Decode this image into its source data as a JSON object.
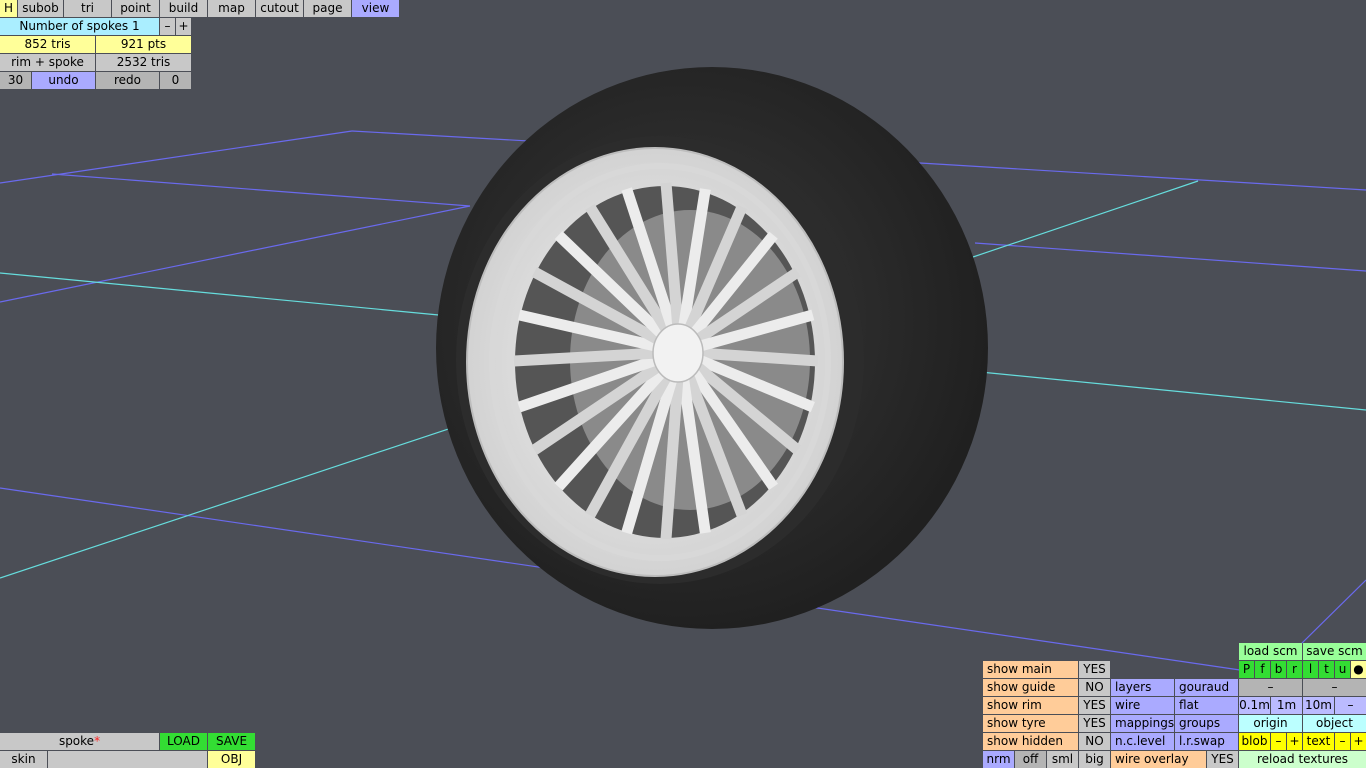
{
  "colors": {
    "background": "#4b4e56",
    "grid_blue": "#6a6aee",
    "grid_cyan": "#66dddd",
    "tyre": "#2a2a2a",
    "rim": "#e6e6e6"
  },
  "menu": {
    "h": "H",
    "subob": "subob",
    "tri": "tri",
    "point": "point",
    "build": "build",
    "map": "map",
    "cutout": "cutout",
    "page": "page",
    "view": "view"
  },
  "info": {
    "param_label": "Number of spokes 1",
    "minus": "–",
    "plus": "+",
    "tris": "852 tris",
    "pts": "921 pts",
    "selection": "rim + spoke",
    "sel_tris": "2532 tris",
    "undo_count": "30",
    "undo": "undo",
    "redo": "redo",
    "redo_count": "0"
  },
  "file": {
    "name": "spoke",
    "modified": "*",
    "load": "LOAD",
    "save": "SAVE",
    "skin": "skin",
    "skin_value": "",
    "obj": "OBJ"
  },
  "display": {
    "show_main": "show main",
    "show_main_val": "YES",
    "show_guide": "show guide",
    "show_guide_val": "NO",
    "show_rim": "show rim",
    "show_rim_val": "YES",
    "show_tyre": "show tyre",
    "show_tyre_val": "YES",
    "show_hidden": "show hidden",
    "show_hidden_val": "NO",
    "layers": "layers",
    "gouraud": "gouraud",
    "wire": "wire",
    "flat": "flat",
    "mappings": "mappings",
    "groups": "groups",
    "nc_level": "n.c.level",
    "lr_swap": "l.r.swap",
    "nrm": "nrm",
    "off": "off",
    "sml": "sml",
    "big": "big",
    "wire_overlay": "wire overlay",
    "wire_overlay_val": "YES"
  },
  "scene": {
    "load_scm": "load scm",
    "save_scm": "save scm",
    "views": [
      "P",
      "f",
      "b",
      "r",
      "l",
      "t",
      "u",
      "●"
    ],
    "dash": "–",
    "scale_01": "0.1m",
    "scale_1": "1m",
    "scale_10": "10m",
    "scale_minus": "–",
    "origin": "origin",
    "object": "object",
    "blob": "blob",
    "blob_minus": "–",
    "blob_plus": "+",
    "text": "text",
    "text_minus": "–",
    "text_plus": "+",
    "reload_textures": "reload textures"
  }
}
